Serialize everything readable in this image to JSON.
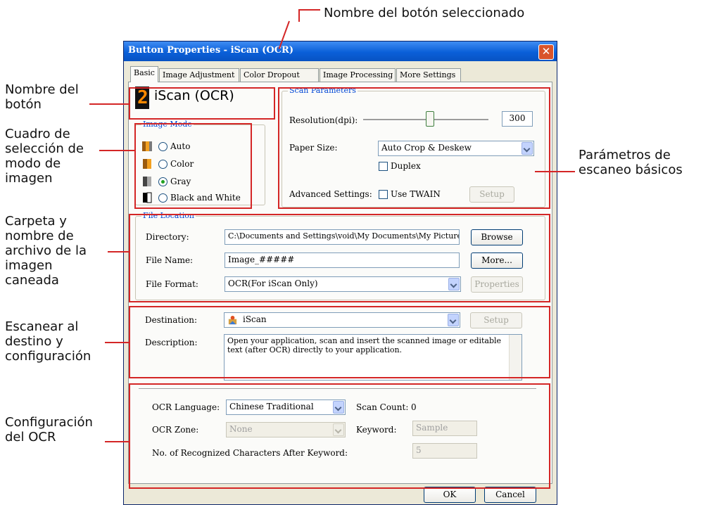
{
  "annotations": {
    "selected_button_name": "Nombre del botón seleccionado",
    "button_name": [
      "Nombre del",
      "botón"
    ],
    "image_mode_box": [
      "Cuadro de",
      "selección de",
      "modo de",
      "imagen"
    ],
    "folder_filename": [
      "Carpeta y",
      "nombre de",
      "archivo de la",
      "imagen",
      "caneada"
    ],
    "destination": [
      "Escanear al",
      "destino y",
      "configuración"
    ],
    "ocr_config": [
      "Configuración",
      "del OCR"
    ],
    "scan_params": [
      "Parámetros de",
      "escaneo básicos"
    ]
  },
  "dialog": {
    "title": "Button Properties - iScan (OCR)",
    "close_glyph": "✕",
    "tabs": [
      "Basic",
      "Image Adjustment",
      "Color Dropout",
      "Image Processing",
      "More Settings"
    ],
    "button_display_name": "iScan (OCR)",
    "button_number": "2"
  },
  "image_mode": {
    "legend": "Image Mode",
    "options": [
      "Auto",
      "Color",
      "Gray",
      "Black and White"
    ],
    "selected": "Gray"
  },
  "scan_parameters": {
    "legend": "Scan Parameters",
    "resolution_label": "Resolution(dpi):",
    "resolution_value": "300",
    "paper_size_label": "Paper Size:",
    "paper_size_value": "Auto Crop & Deskew",
    "duplex_label": "Duplex",
    "advanced_label": "Advanced Settings:",
    "use_twain_label": "Use TWAIN",
    "setup_label": "Setup"
  },
  "file_location": {
    "legend": "File Location",
    "directory_label": "Directory:",
    "directory_value": "C:\\Documents and Settings\\void\\My Documents\\My Pictures",
    "browse_label": "Browse",
    "file_name_label": "File Name:",
    "file_name_value": "Image_#####",
    "more_label": "More...",
    "file_format_label": "File Format:",
    "file_format_value": "OCR(For iScan Only)",
    "properties_label": "Properties"
  },
  "destination": {
    "label": "Destination:",
    "value": "iScan",
    "setup_label": "Setup",
    "description_label": "Description:",
    "description_text": "Open your application, scan and insert the scanned image or editable text (after OCR) directly to your application."
  },
  "ocr": {
    "language_label": "OCR Language:",
    "language_value": "Chinese Traditional",
    "scan_count_label": "Scan Count:",
    "scan_count_value": "0",
    "zone_label": "OCR Zone:",
    "zone_value": "None",
    "keyword_label": "Keyword:",
    "keyword_value": "Sample",
    "recognized_label": "No. of Recognized Characters After Keyword:",
    "recognized_value": "5"
  },
  "footer": {
    "ok_label": "OK",
    "cancel_label": "Cancel"
  },
  "colors": {
    "annotation_red": "#d42626",
    "title_blue": "#0a5fd8",
    "dialog_bg": "#ece9d8"
  }
}
